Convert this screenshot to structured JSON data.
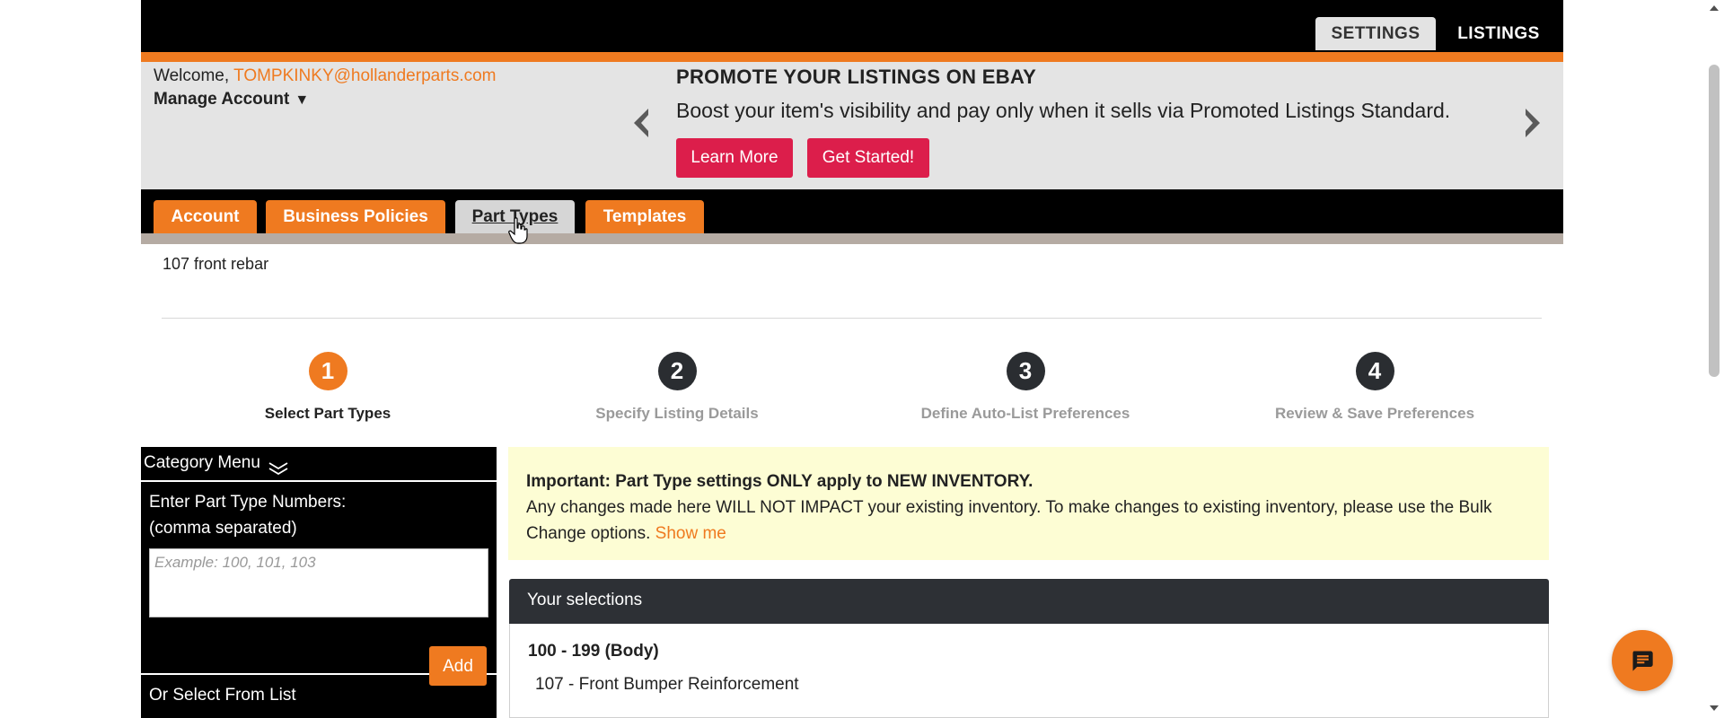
{
  "header": {
    "tabs": [
      {
        "label": "SETTINGS"
      },
      {
        "label": "LISTINGS"
      }
    ]
  },
  "account": {
    "welcome_prefix": "Welcome, ",
    "email": "TOMPKINKY@hollanderparts.com",
    "manage_label": "Manage Account",
    "manage_caret": "▼"
  },
  "promo": {
    "title": "PROMOTE YOUR LISTINGS ON EBAY",
    "text": "Boost your item's visibility and pay only when it sells via Promoted Listings Standard.",
    "learn_more": "Learn More",
    "get_started": "Get Started!"
  },
  "nav": {
    "tabs": [
      {
        "label": "Account"
      },
      {
        "label": "Business Policies"
      },
      {
        "label": "Part Types"
      },
      {
        "label": "Templates"
      }
    ],
    "active": "Part Types"
  },
  "subtitle": "107 front rebar",
  "steps": [
    {
      "number": "1",
      "label": "Select Part Types",
      "active": true
    },
    {
      "number": "2",
      "label": "Specify Listing Details",
      "active": false
    },
    {
      "number": "3",
      "label": "Define Auto-List Preferences",
      "active": false
    },
    {
      "number": "4",
      "label": "Review & Save Preferences",
      "active": false
    }
  ],
  "sidebar": {
    "category_menu": "Category Menu",
    "enter_label_line1": "Enter Part Type Numbers:",
    "enter_label_line2": "(comma separated)",
    "input_placeholder": "Example: 100, 101, 103",
    "add_button": "Add",
    "or_select": "Or Select From List"
  },
  "notice": {
    "bold": "Important: Part Type settings ONLY apply to NEW INVENTORY.",
    "text": "Any changes made here WILL NOT IMPACT your existing inventory. To make changes to existing inventory, please use the Bulk Change options.",
    "link": "Show me"
  },
  "selections": {
    "header": "Your selections",
    "group": "100 - 199 (Body)",
    "items": [
      "107 - Front Bumper Reinforcement"
    ]
  },
  "colors": {
    "orange": "#ef7a20",
    "red": "#dc1e4b",
    "dark": "#2d3035",
    "notice_bg": "#fdfdd4"
  },
  "icons": {
    "chat": "chat-bubble-icon",
    "prev": "chevron-left-icon",
    "next": "chevron-right-icon",
    "menu_toggle": "double-chevron-down-icon"
  }
}
